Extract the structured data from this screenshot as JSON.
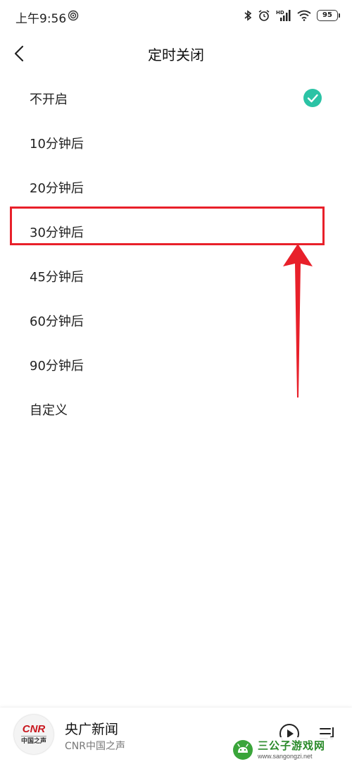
{
  "status_bar": {
    "time": "上午9:56",
    "battery": "95",
    "icons": [
      "signal-broadcast-icon",
      "bluetooth-icon",
      "alarm-icon",
      "hd-cell-signal-icon",
      "wifi-icon",
      "battery-icon"
    ]
  },
  "header": {
    "back_icon": "chevron-left-icon",
    "title": "定时关闭"
  },
  "options": [
    {
      "label": "不开启",
      "selected": true
    },
    {
      "label": "10分钟后",
      "selected": false
    },
    {
      "label": "20分钟后",
      "selected": false
    },
    {
      "label": "30分钟后",
      "selected": false
    },
    {
      "label": "45分钟后",
      "selected": false
    },
    {
      "label": "60分钟后",
      "selected": false
    },
    {
      "label": "90分钟后",
      "selected": false
    },
    {
      "label": "自定义",
      "selected": false
    }
  ],
  "colors": {
    "check": "#2bc3a5",
    "annotation": "#e8202a",
    "logo_red": "#c8161d"
  },
  "player": {
    "logo_text": "CNR",
    "logo_sub": "中国之声",
    "title": "央广新闻",
    "subtitle": "CNR中国之声",
    "play_icon": "play-circle-icon",
    "playlist_icon": "playlist-icon"
  },
  "watermark": {
    "title": "三公子游戏网",
    "url": "www.sangongzi.net"
  }
}
